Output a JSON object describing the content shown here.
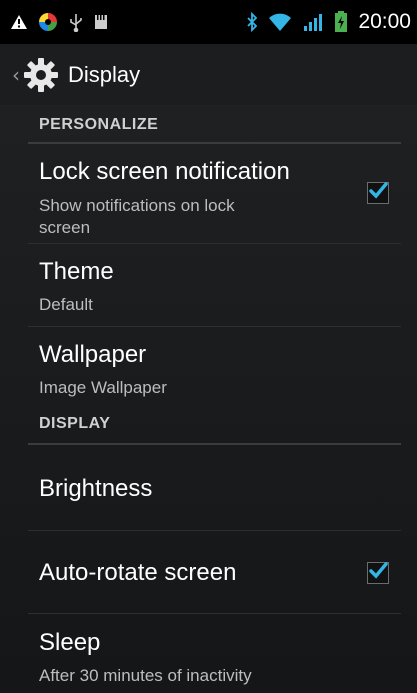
{
  "status_bar": {
    "time": "20:00",
    "icons": [
      "warning-icon",
      "notification-app-icon",
      "usb-icon",
      "storage-icon",
      "bluetooth-icon",
      "wifi-icon",
      "signal-icon",
      "battery-charging-icon"
    ],
    "colors": {
      "accent": "#33b5e5",
      "battery": "#4caf50"
    }
  },
  "action_bar": {
    "back_symbol": "‹",
    "title": "Display",
    "icon": "gear-icon"
  },
  "sections": {
    "personalize": "PERSONALIZE",
    "display": "DISPLAY"
  },
  "items": {
    "lock_screen": {
      "title": "Lock screen notification",
      "summary_line1": "Show notifications on lock",
      "summary_line2": "screen",
      "checked": true
    },
    "theme": {
      "title": "Theme",
      "summary": "Default"
    },
    "wallpaper": {
      "title": "Wallpaper",
      "summary": "Image Wallpaper"
    },
    "brightness": {
      "title": "Brightness"
    },
    "auto_rotate": {
      "title": "Auto-rotate screen",
      "checked": true
    },
    "sleep": {
      "title": "Sleep",
      "summary": "After 30 minutes of inactivity"
    }
  }
}
